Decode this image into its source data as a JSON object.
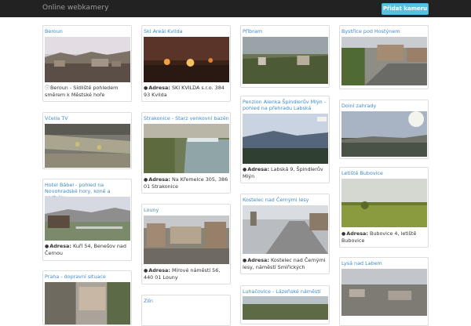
{
  "navbar": {
    "brand": "Online webkamery",
    "add_button": "Přidat kameru"
  },
  "address_label": "Adresa:",
  "cards": {
    "beroun": {
      "title": "Beroun",
      "desc": "Beroun - Sídliště pohledem směrem k Městské hoře"
    },
    "vcelia": {
      "title": "Včelia TV"
    },
    "babel": {
      "title": "Hotel Bábel - pohled na Novohradské hory, koně a pastviny",
      "address": "Kuří 54, Benešov nad Černou"
    },
    "praha": {
      "title": "Praha - dopravní situace"
    },
    "kvilda": {
      "title": "Ski Areál Kvilda",
      "address": "SKI KVILDA s.r.o. 384 93 Kvilda"
    },
    "strakonice": {
      "title": "Strakonice - Starz venkovní bazén",
      "address": "Na Křemelce 305, 386 01 Strakonice"
    },
    "louny": {
      "title": "Louny",
      "address": "Mírové náměstí 56, 440 01 Louny"
    },
    "zlin": {
      "title": "Zlín"
    },
    "pribram": {
      "title": "Příbram"
    },
    "alenka": {
      "title": "Penzion Alenka Špindlerův Mlýn - pohled na přehradu Labská",
      "address": "Labská 9, Špindlerův Mlýn"
    },
    "kostelec": {
      "title": "Kostelec nad Černými lesy",
      "address": "Kostelec nad Černými lesy, náměstí Smiřických"
    },
    "luhacovice": {
      "title": "Luhačovice - Lázeňské náměstí"
    },
    "bystrice": {
      "title": "Bystřice pod Hostýnem"
    },
    "dolni": {
      "title": "Dolní zahrady"
    },
    "bubovice": {
      "title": "Letiště Bubovice",
      "address": "Bubovice 4, letiště Bubovice"
    },
    "lysa": {
      "title": "Lysá nad Labem"
    }
  },
  "colors": {
    "navbar": "#222222",
    "link": "#428bca",
    "button": "#5bc0de"
  },
  "icons": {
    "info": "info-circle-icon",
    "marker": "map-marker-icon"
  }
}
